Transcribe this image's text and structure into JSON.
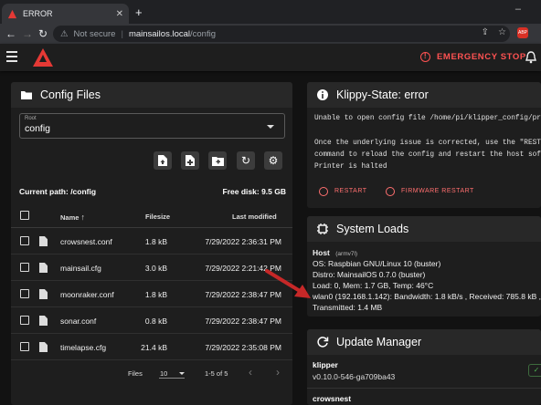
{
  "browser": {
    "tab_title": "ERROR",
    "tab_close": "✕",
    "new_tab": "+",
    "not_secure": "Not secure",
    "separator": "|",
    "url_host": "mainsailos.local",
    "url_path": "/config",
    "ext_badge": "ABP"
  },
  "header": {
    "emergency_stop": "EMERGENCY STOP"
  },
  "config_files": {
    "title": "Config Files",
    "root_label": "Root",
    "root_value": "config",
    "current_path_label": "Current path: /config",
    "free_disk": "Free disk: 9.5 GB",
    "columns": {
      "name": "Name",
      "filesize": "Filesize",
      "modified": "Last modified"
    },
    "files": [
      {
        "name": "crowsnest.conf",
        "size": "1.8 kB",
        "modified": "7/29/2022 2:36:31 PM"
      },
      {
        "name": "mainsail.cfg",
        "size": "3.0 kB",
        "modified": "7/29/2022 2:21:42 PM"
      },
      {
        "name": "moonraker.conf",
        "size": "1.8 kB",
        "modified": "7/29/2022 2:38:47 PM"
      },
      {
        "name": "sonar.conf",
        "size": "0.8 kB",
        "modified": "7/29/2022 2:38:47 PM"
      },
      {
        "name": "timelapse.cfg",
        "size": "21.4 kB",
        "modified": "7/29/2022 2:35:08 PM"
      }
    ],
    "footer": {
      "files_label": "Files",
      "per_page": "10",
      "range": "1-5 of 5"
    }
  },
  "klippy": {
    "title": "Klippy-State: error",
    "line1": "Unable to open config file /home/pi/klipper_config/prin",
    "line2": "Once the underlying issue is corrected, use the \"RESTAR",
    "line3": "command to reload the config and restart the host softw",
    "line4": "Printer is halted",
    "restart": "RESTART",
    "firmware_restart": "FIRMWARE RESTART"
  },
  "system_loads": {
    "title": "System Loads",
    "host_label": "Host",
    "host_arch": "(armv7l)",
    "os": "OS: Raspbian GNU/Linux 10 (buster)",
    "distro": "Distro: MainsailOS 0.7.0 (buster)",
    "load": "Load: 0, Mem: 1.7 GB, Temp: 46°C",
    "wlan": "wlan0 (192.168.1.142): Bandwidth: 1.8 kB/s , Received: 785.8 kB ,",
    "transmitted": "Transmitted: 1.4 MB"
  },
  "update_manager": {
    "title": "Update Manager",
    "items": [
      {
        "name": "klipper",
        "version": "v0.10.0-546-ga709ba43"
      },
      {
        "name": "crowsnest",
        "version": ""
      }
    ]
  },
  "colors": {
    "accent_red": "#ff5252",
    "panel_bg": "#1e1e1e",
    "panel_header": "#282828"
  }
}
